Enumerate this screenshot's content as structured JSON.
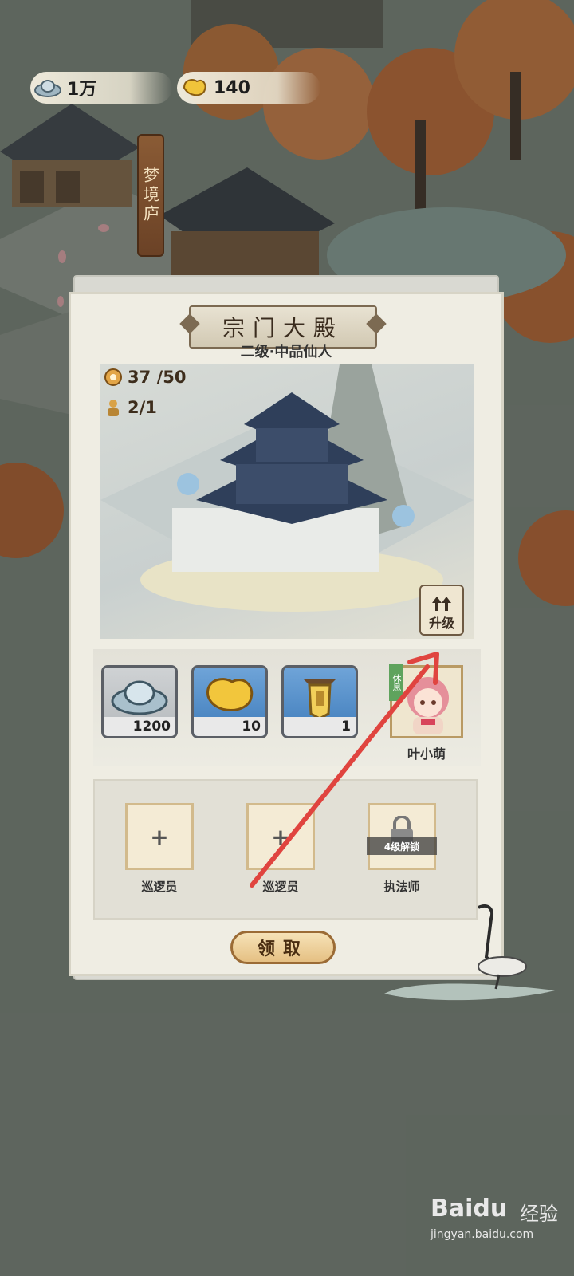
{
  "hud": {
    "silver": "1万",
    "gold": "140"
  },
  "map": {
    "sign_label": "梦境庐"
  },
  "building_panel": {
    "title": "宗门大殿",
    "subtitle": "二级·中品仙人",
    "stats": {
      "capacity": "37 /50",
      "workers": "2/1"
    },
    "upgrade_label": "升级",
    "costs": [
      {
        "item": "silver-ingot-icon",
        "count": "1200"
      },
      {
        "item": "gold-nugget-icon",
        "count": "10"
      },
      {
        "item": "token-icon",
        "count": "1"
      }
    ],
    "character": {
      "status_tag": "休息",
      "name": "叶小萌"
    },
    "slots": [
      {
        "label": "巡逻员",
        "locked": false
      },
      {
        "label": "巡逻员",
        "locked": false
      },
      {
        "label": "执法师",
        "locked": true,
        "lock_text": "4级解锁"
      }
    ],
    "claim_label": "领取"
  },
  "watermark": {
    "brand": "Baidu",
    "suffix": "经验",
    "url": "jingyan.baidu.com"
  },
  "colors": {
    "panel": "#efede3",
    "accent_arrow": "#e0443f",
    "button_gold": "#e5c083"
  }
}
